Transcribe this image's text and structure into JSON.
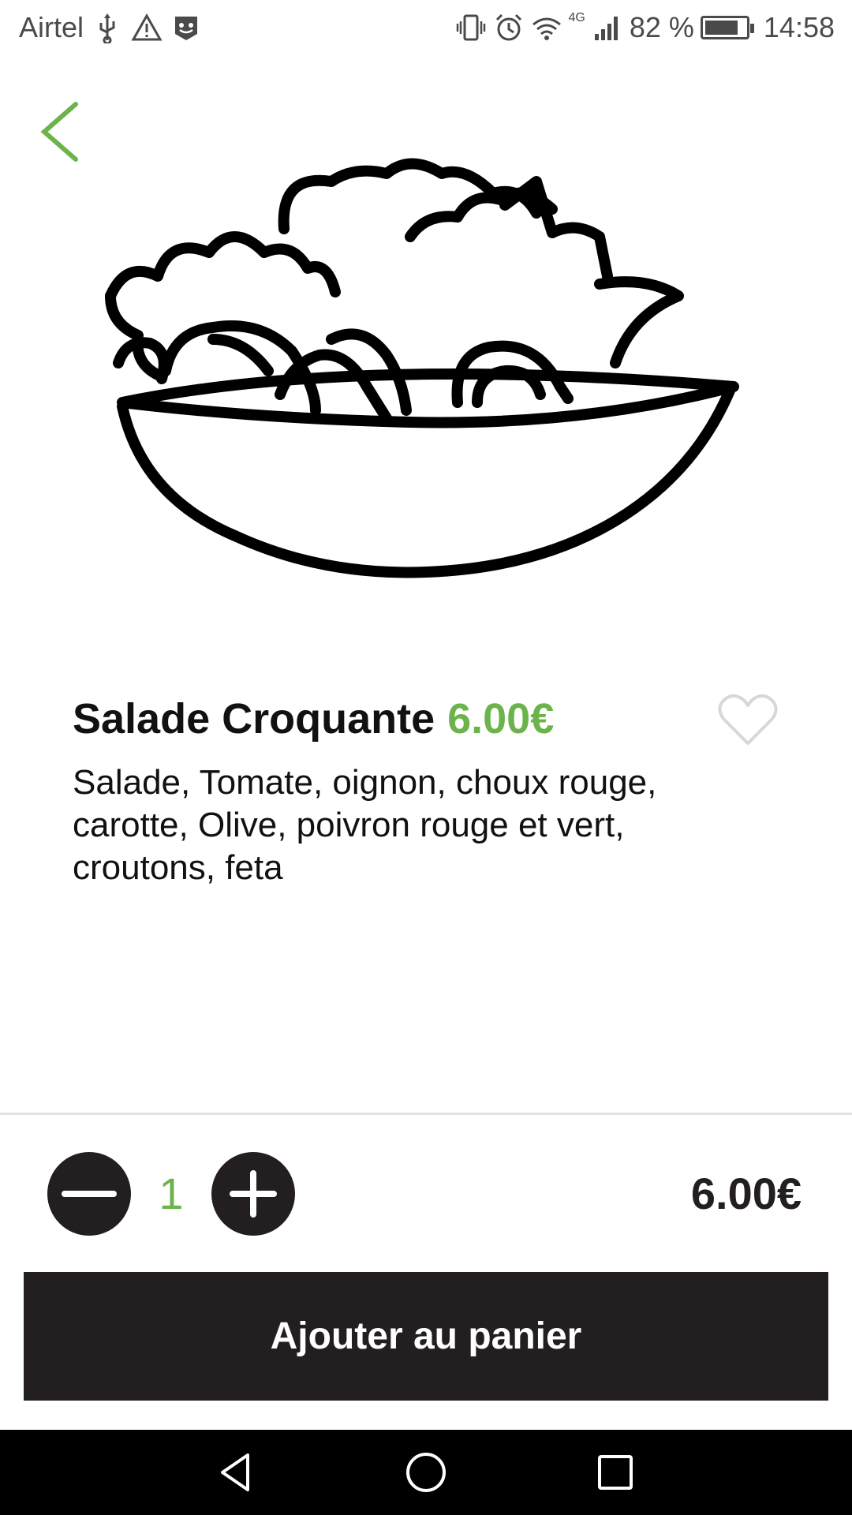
{
  "status_bar": {
    "carrier": "Airtel",
    "network": "4G",
    "battery_percent": "82 %",
    "battery_level": 0.82,
    "time": "14:58",
    "icons": [
      "usb-icon",
      "warning-icon",
      "notification-app-icon",
      "vibrate-icon",
      "alarm-icon",
      "wifi-icon",
      "signal-icon",
      "battery-icon"
    ]
  },
  "header": {
    "back_icon": "chevron-left-icon"
  },
  "product": {
    "name": "Salade Croquante",
    "price": "6.00€",
    "description": "Salade, Tomate, oignon, choux rouge, carotte, Olive, poivron rouge et vert, croutons, feta",
    "image_icon": "salad-bowl-illustration",
    "favorite_icon": "heart-outline-icon"
  },
  "cart": {
    "quantity": "1",
    "total": "6.00€",
    "add_button_label": "Ajouter au panier"
  },
  "colors": {
    "accent_green": "#6db34b",
    "dark": "#231f20",
    "nav_background": "#000000"
  },
  "nav": {
    "icons": [
      "back-triangle-icon",
      "home-circle-icon",
      "recents-square-icon"
    ]
  }
}
